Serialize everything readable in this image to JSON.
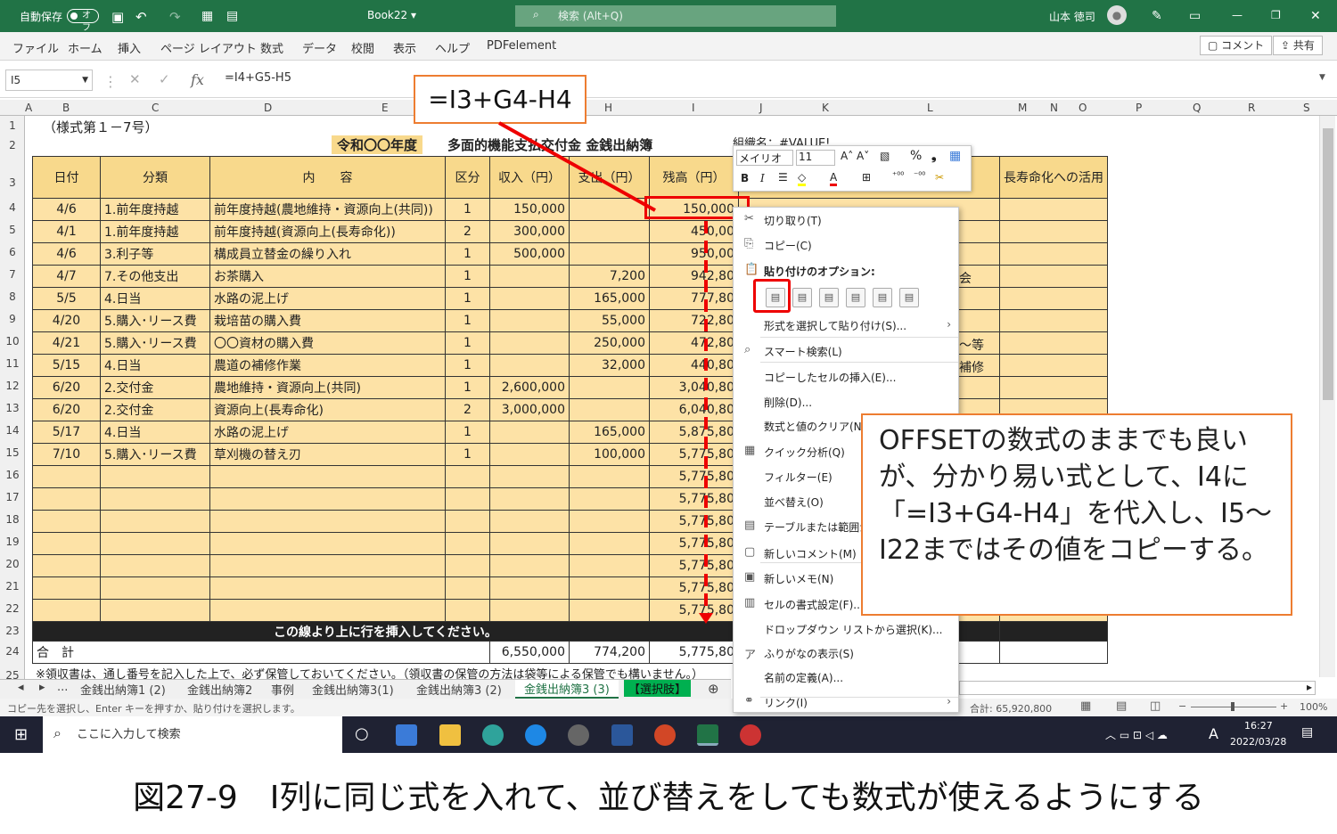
{
  "titlebar": {
    "autosave": "自動保存",
    "toggle": "オフ",
    "book": "Book22 ▾",
    "search": "検索 (Alt+Q)",
    "user": "山本 徳司"
  },
  "ribbon": {
    "tabs": [
      "ファイル",
      "ホーム",
      "挿入",
      "ページ レイアウト",
      "数式",
      "データ",
      "校閲",
      "表示",
      "ヘルプ",
      "PDFelement"
    ],
    "comment": "コメント",
    "share": "共有"
  },
  "formula_bar": {
    "cell": "I5",
    "formula": "=I4+G5-H5"
  },
  "columns": [
    "A",
    "B",
    "C",
    "D",
    "E",
    "F",
    "G",
    "H",
    "I",
    "J",
    "K",
    "L",
    "M",
    "N",
    "O",
    "P",
    "Q",
    "R",
    "S"
  ],
  "rows": [
    "1",
    "2",
    "3",
    "4",
    "5",
    "6",
    "7",
    "8",
    "9",
    "10",
    "11",
    "12",
    "13",
    "14",
    "15",
    "16",
    "17",
    "18",
    "19",
    "20",
    "21",
    "22",
    "23",
    "24",
    "25"
  ],
  "sheet": {
    "r1": "（様式第１－7号）",
    "year": "令和〇〇年度",
    "title": "多面的機能支払交付金 金銭出納簿",
    "org": "組織名：#VALUE!",
    "headers": [
      "日付",
      "分類",
      "内　　容",
      "区分",
      "収入（円）",
      "支出（円）",
      "残高（円）"
    ],
    "extra_header": "長寿命化への活用",
    "data": [
      [
        "4/6",
        "1.前年度持越",
        "前年度持越(農地維持・資源向上(共同))",
        "1",
        "150,000",
        "",
        "150,000"
      ],
      [
        "4/1",
        "1.前年度持越",
        "前年度持越(資源向上(長寿命化))",
        "2",
        "300,000",
        "",
        "450,00"
      ],
      [
        "4/6",
        "3.利子等",
        "構成員立替金の繰り入れ",
        "1",
        "500,000",
        "",
        "950,00"
      ],
      [
        "4/7",
        "7.その他支出",
        "お茶購入",
        "1",
        "",
        "7,200",
        "942,80"
      ],
      [
        "5/5",
        "4.日当",
        "水路の泥上げ",
        "1",
        "",
        "165,000",
        "777,80"
      ],
      [
        "4/20",
        "5.購入･リース費",
        "栽培苗の購入費",
        "1",
        "",
        "55,000",
        "722,80"
      ],
      [
        "4/21",
        "5.購入･リース費",
        "〇〇資材の購入費",
        "1",
        "",
        "250,000",
        "472,80"
      ],
      [
        "5/15",
        "4.日当",
        "農道の補修作業",
        "1",
        "",
        "32,000",
        "440,80"
      ],
      [
        "6/20",
        "2.交付金",
        "農地維持・資源向上(共同)",
        "1",
        "2,600,000",
        "",
        "3,040,80"
      ],
      [
        "6/20",
        "2.交付金",
        "資源向上(長寿命化)",
        "2",
        "3,000,000",
        "",
        "6,040,80"
      ],
      [
        "5/17",
        "4.日当",
        "水路の泥上げ",
        "1",
        "",
        "165,000",
        "5,875,80"
      ],
      [
        "7/10",
        "5.購入･リース費",
        "草刈機の替え刃",
        "1",
        "",
        "100,000",
        "5,775,80"
      ],
      [
        "",
        "",
        "",
        "",
        "",
        "",
        "5,775,80"
      ],
      [
        "",
        "",
        "",
        "",
        "",
        "",
        "5,775,80"
      ],
      [
        "",
        "",
        "",
        "",
        "",
        "",
        "5,775,80"
      ],
      [
        "",
        "",
        "",
        "",
        "",
        "",
        "5,775,80"
      ],
      [
        "",
        "",
        "",
        "",
        "",
        "",
        "5,775,80"
      ],
      [
        "",
        "",
        "",
        "",
        "",
        "",
        "5,775,80"
      ],
      [
        "",
        "",
        "",
        "",
        "",
        "",
        "5,775,80"
      ]
    ],
    "insert_row": "この線より上に行を挿入してください。",
    "total": {
      "label": "合　計",
      "income": "6,550,000",
      "expense": "774,200",
      "balance": "5,775,80"
    },
    "note": "※領収書は、通し番号を記入した上で、必ず保管しておいてください。（領収書の保管の方法は袋等による保管でも構いません。）",
    "peek": [
      "会",
      "～等",
      "補修"
    ]
  },
  "sheet_tabs": [
    "...",
    "金銭出納簿1 (2)",
    "金銭出納簿2",
    "事例",
    "金銭出納簿3(1)",
    "金銭出納簿3 (2)",
    "金銭出納簿3 (3)",
    "【選択肢】"
  ],
  "status": {
    "msg": "コピー先を選択し、Enter キーを押すか、貼り付けを選択します。",
    "sum": "合計: 65,920,800",
    "zoom": "100%"
  },
  "taskbar": {
    "search": "ここに入力して検索",
    "time": "16:27",
    "date": "2022/03/28",
    "ime": "A"
  },
  "mini_toolbar": {
    "font": "メイリオ",
    "size": "11"
  },
  "context_menu": [
    {
      "label": "切り取り(T)",
      "icon": "scissors-icon"
    },
    {
      "label": "コピー(C)",
      "icon": "copy-icon"
    },
    {
      "label": "貼り付けのオプション:",
      "icon": "paste-icon"
    },
    {
      "label": "形式を選択して貼り付け(S)...",
      "icon": ""
    },
    {
      "label": "スマート検索(L)",
      "icon": "search-icon"
    },
    {
      "label": "コピーしたセルの挿入(E)...",
      "icon": ""
    },
    {
      "label": "削除(D)...",
      "icon": ""
    },
    {
      "label": "数式と値のクリア(N)",
      "icon": ""
    },
    {
      "label": "クイック分析(Q)",
      "icon": "quick-analysis-icon"
    },
    {
      "label": "フィルター(E)",
      "icon": ""
    },
    {
      "label": "並べ替え(O)",
      "icon": ""
    },
    {
      "label": "テーブルまたは範囲から デ",
      "icon": "table-icon"
    },
    {
      "label": "新しいコメント(M)",
      "icon": "comment-icon"
    },
    {
      "label": "新しいメモ(N)",
      "icon": "note-icon"
    },
    {
      "label": "セルの書式設定(F)...",
      "icon": "format-icon"
    },
    {
      "label": "ドロップダウン リストから選択(K)...",
      "icon": ""
    },
    {
      "label": "ふりがなの表示(S)",
      "icon": "furigana-icon"
    },
    {
      "label": "名前の定義(A)...",
      "icon": ""
    },
    {
      "label": "リンク(I)",
      "icon": "link-icon"
    }
  ],
  "callouts": {
    "formula": "=I3+G4-H4",
    "note": "OFFSETの数式のままでも良いが、分かり易い式として、I4に「=I3+G4-H4」を代入し、I5～I22まではその値をコピーする。"
  },
  "caption": "図27-9　I列に同じ式を入れて、並び替えをしても数式が使えるようにする"
}
